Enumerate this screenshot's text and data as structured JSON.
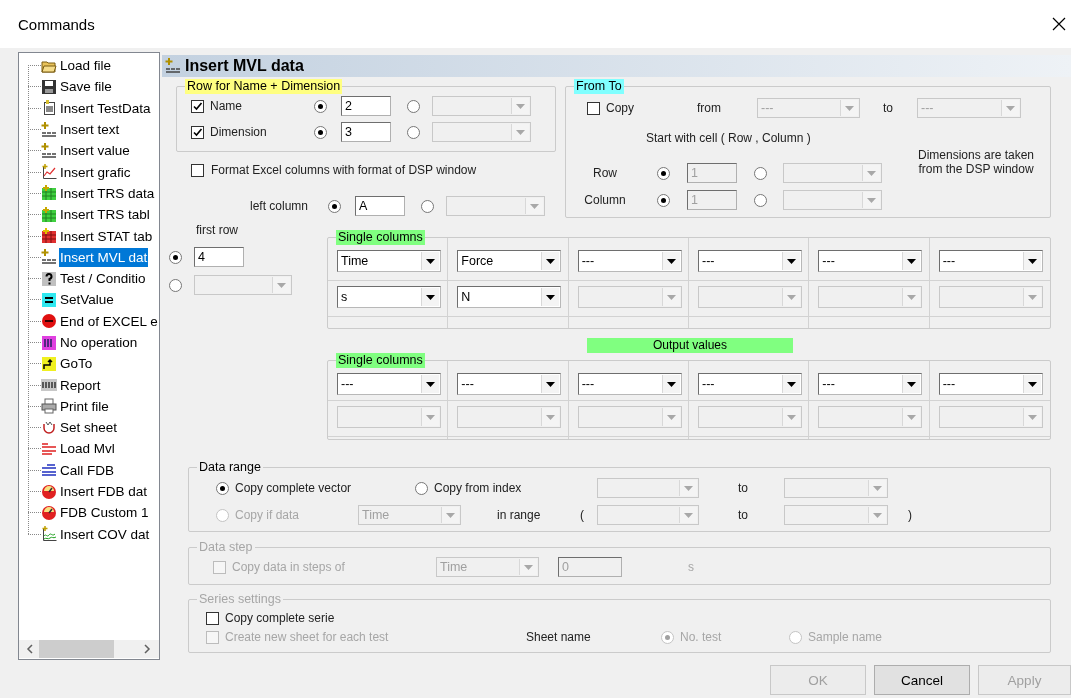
{
  "window": {
    "title": "Commands"
  },
  "tree": {
    "items": [
      {
        "label": "Load file",
        "kind": "folder",
        "selected": false
      },
      {
        "label": "Save file",
        "kind": "disk",
        "selected": false
      },
      {
        "label": "Insert TestData",
        "kind": "doc",
        "selected": false
      },
      {
        "label": "Insert text",
        "kind": "plus",
        "selected": false
      },
      {
        "label": "Insert value",
        "kind": "plus",
        "selected": false
      },
      {
        "label": "Insert grafic",
        "kind": "chart",
        "selected": false
      },
      {
        "label": "Insert TRS data",
        "kind": "gridg",
        "selected": false
      },
      {
        "label": "Insert TRS tabl",
        "kind": "gridg",
        "selected": false
      },
      {
        "label": "Insert STAT tab",
        "kind": "gridr",
        "selected": false
      },
      {
        "label": "Insert MVL dat",
        "kind": "plus",
        "selected": true
      },
      {
        "label": "Test / Conditio",
        "kind": "question",
        "selected": false
      },
      {
        "label": "SetValue",
        "kind": "equals",
        "selected": false
      },
      {
        "label": "End of EXCEL e",
        "kind": "stop",
        "selected": false
      },
      {
        "label": "No operation",
        "kind": "block",
        "selected": false
      },
      {
        "label": "GoTo",
        "kind": "goto",
        "selected": false
      },
      {
        "label": "Report",
        "kind": "tag",
        "selected": false
      },
      {
        "label": "Print file",
        "kind": "printer",
        "selected": false
      },
      {
        "label": "Set sheet",
        "kind": "hook",
        "selected": false
      },
      {
        "label": "Load Mvl",
        "kind": "redlabel",
        "selected": false
      },
      {
        "label": "Call FDB",
        "kind": "bluelabel",
        "selected": false
      },
      {
        "label": "Insert FDB dat",
        "kind": "gauge",
        "selected": false
      },
      {
        "label": "FDB Custom 1",
        "kind": "gauge",
        "selected": false
      },
      {
        "label": "Insert COV dat",
        "kind": "wave",
        "selected": false
      }
    ]
  },
  "panel": {
    "title": "Insert MVL data",
    "name_dimension": {
      "title": "Row for Name + Dimension",
      "rows": [
        {
          "label": "Name",
          "checked": true,
          "use_value": true,
          "value": "2"
        },
        {
          "label": "Dimension",
          "checked": true,
          "use_value": true,
          "value": "3"
        }
      ]
    },
    "format_excel": {
      "label": "Format Excel columns with format of DSP window",
      "checked": false
    },
    "left_column": {
      "label": "left column",
      "use_value": true,
      "value": "A"
    },
    "first_row": {
      "label": "first row",
      "use_value": true,
      "value": "4"
    },
    "from_to": {
      "title": "From To",
      "copy": {
        "label": "Copy",
        "checked": false
      },
      "from_label": "from",
      "from_value": "---",
      "to_label": "to",
      "to_value": "---",
      "start_label": "Start with cell  ( Row , Column )",
      "rows": [
        {
          "label": "Row",
          "use_value": true,
          "value": "1"
        },
        {
          "label": "Column",
          "use_value": true,
          "value": "1"
        }
      ],
      "note": "Dimensions are taken from the DSP window"
    },
    "input_columns": {
      "title": "Single columns",
      "columns": [
        {
          "name": "Time",
          "unit": "s"
        },
        {
          "name": "Force",
          "unit": "N"
        },
        {
          "name": "---"
        },
        {
          "name": "---"
        },
        {
          "name": "---"
        },
        {
          "name": "---"
        }
      ]
    },
    "output_label": "Output values",
    "output_columns": {
      "title": "Single columns",
      "columns": [
        {
          "name": "---"
        },
        {
          "name": "---"
        },
        {
          "name": "---"
        },
        {
          "name": "---"
        },
        {
          "name": "---"
        },
        {
          "name": "---"
        }
      ]
    },
    "data_range": {
      "title": "Data range",
      "options": [
        {
          "label": "Copy complete vector",
          "selected": true,
          "disabled": false
        },
        {
          "label": "Copy from index",
          "selected": false,
          "disabled": false
        },
        {
          "label": "Copy if data",
          "selected": false,
          "disabled": true
        }
      ],
      "index_to_label": "to",
      "data_value": "Time",
      "in_range_label": "in range",
      "open_paren": "(",
      "range_to_label": "to",
      "close_paren": ")"
    },
    "data_step": {
      "title": "Data step",
      "disabled": true,
      "checkbox": {
        "label": "Copy data in steps of",
        "checked": false
      },
      "quantity": "Time",
      "value": "0",
      "unit": "s"
    },
    "series": {
      "title": "Series settings",
      "title_disabled": true,
      "items": [
        {
          "label": "Copy complete serie",
          "checked": false,
          "disabled": false
        },
        {
          "label": "Create new sheet for each test",
          "checked": false,
          "disabled": true
        }
      ],
      "sheet_name_label": "Sheet name",
      "sheet_options": [
        {
          "label": "No. test",
          "selected": true,
          "disabled": true
        },
        {
          "label": "Sample name",
          "selected": false,
          "disabled": true
        }
      ]
    }
  },
  "buttons": [
    {
      "label": "OK",
      "disabled": true
    },
    {
      "label": "Cancel",
      "disabled": false
    },
    {
      "label": "Apply",
      "disabled": true
    }
  ]
}
